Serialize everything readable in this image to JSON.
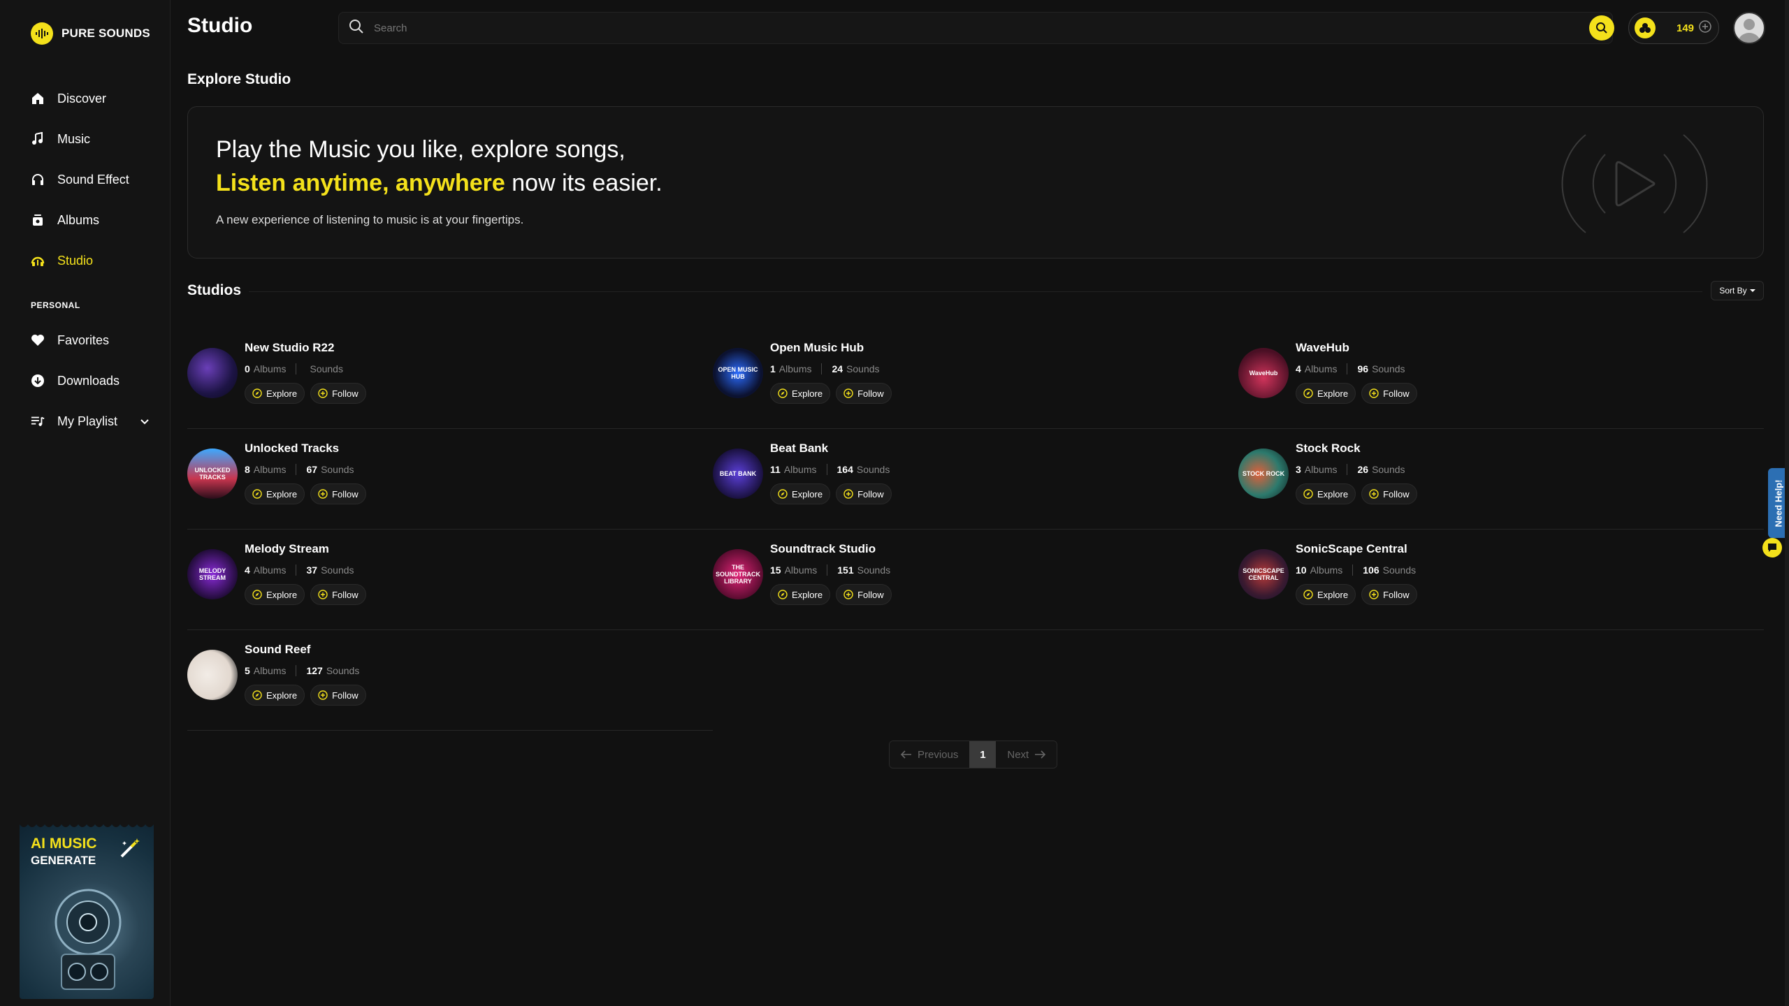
{
  "brand": {
    "name": "PURE SOUNDS"
  },
  "sidebar": {
    "items": [
      {
        "label": "Discover",
        "icon": "home-icon"
      },
      {
        "label": "Music",
        "icon": "music-note-icon"
      },
      {
        "label": "Sound Effect",
        "icon": "headphones-icon"
      },
      {
        "label": "Albums",
        "icon": "album-icon"
      },
      {
        "label": "Studio",
        "icon": "studio-icon",
        "active": true
      }
    ],
    "section_label": "PERSONAL",
    "personal_items": [
      {
        "label": "Favorites",
        "icon": "heart-icon"
      },
      {
        "label": "Downloads",
        "icon": "download-icon"
      },
      {
        "label": "My Playlist",
        "icon": "playlist-icon"
      }
    ],
    "promo": {
      "title": "AI MUSIC",
      "subtitle": "GENERATE"
    }
  },
  "header": {
    "title": "Studio",
    "search_placeholder": "Search",
    "credits": "149"
  },
  "banner": {
    "heading": "Explore Studio",
    "line1": "Play the Music you like, explore songs,",
    "line2_highlight": "Listen anytime, anywhere",
    "line2_rest": " now its easier.",
    "description": "A new experience of listening to music is at your fingertips."
  },
  "studios": {
    "heading": "Studios",
    "sort_label": "Sort By",
    "albums_label": "Albums",
    "sounds_label": "Sounds",
    "explore_label": "Explore",
    "follow_label": "Follow",
    "items": [
      {
        "name": "New Studio R22",
        "albums": "0",
        "sounds": "",
        "thumb_text": ""
      },
      {
        "name": "Open Music Hub",
        "albums": "1",
        "sounds": "24",
        "thumb_text": "OPEN MUSIC HUB"
      },
      {
        "name": "WaveHub",
        "albums": "4",
        "sounds": "96",
        "thumb_text": "WaveHub"
      },
      {
        "name": "Unlocked Tracks",
        "albums": "8",
        "sounds": "67",
        "thumb_text": "UNLOCKED TRACKS"
      },
      {
        "name": "Beat Bank",
        "albums": "11",
        "sounds": "164",
        "thumb_text": "BEAT BANK"
      },
      {
        "name": "Stock Rock",
        "albums": "3",
        "sounds": "26",
        "thumb_text": "STOCK ROCK"
      },
      {
        "name": "Melody Stream",
        "albums": "4",
        "sounds": "37",
        "thumb_text": "MELODY STREAM"
      },
      {
        "name": "Soundtrack Studio",
        "albums": "15",
        "sounds": "151",
        "thumb_text": "THE SOUNDTRACK LIBRARY"
      },
      {
        "name": "SonicScape Central",
        "albums": "10",
        "sounds": "106",
        "thumb_text": "SONICSCAPE CENTRAL"
      },
      {
        "name": "Sound Reef",
        "albums": "5",
        "sounds": "127",
        "thumb_text": ""
      }
    ]
  },
  "pagination": {
    "previous": "Previous",
    "current": "1",
    "next": "Next"
  },
  "help": {
    "label": "Need Help!"
  },
  "colors": {
    "accent": "#f4e11b",
    "background": "#111111",
    "help": "#2c6fb3"
  }
}
